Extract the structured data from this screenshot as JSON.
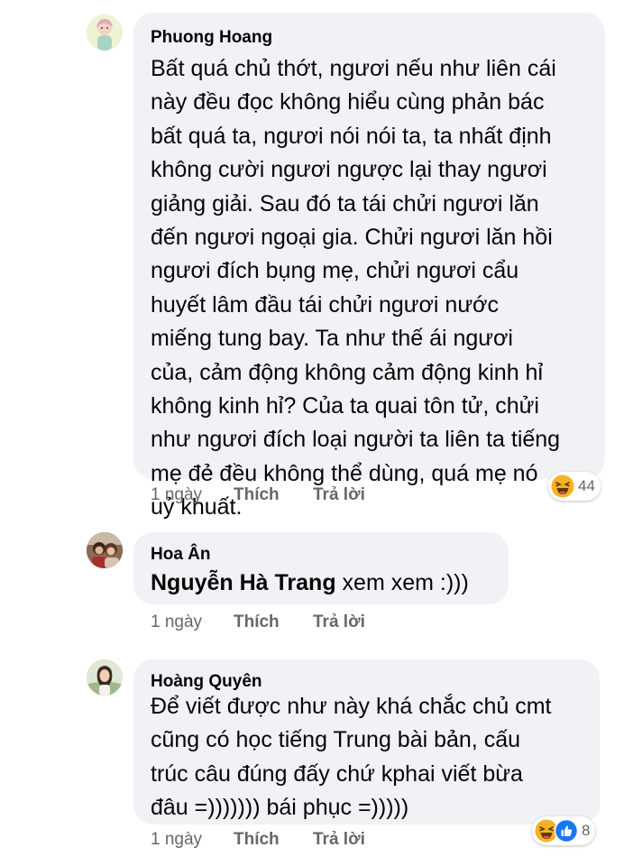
{
  "comments": [
    {
      "author": "Phuong Hoang",
      "lines": [
        "Bất quá chủ thớt, ngươi nếu như liên cái",
        "này đều đọc không hiểu cùng phản bác",
        "bất quá ta, ngươi nói nói ta, ta nhất định",
        "không cười ngươi ngược lại thay ngươi",
        "giảng giải. Sau đó ta tái chửi ngươi lăn",
        "đến ngươi ngoại gia. Chửi ngươi lăn hồi",
        "ngươi đích bụng mẹ, chửi ngươi cẩu",
        "huyết lâm đầu tái chửi ngươi nước",
        "miếng tung bay. Ta như thế ái ngươi",
        "của, cảm động không cảm động kinh hỉ",
        "không kinh hỉ? Của ta quai tôn tử, chửi",
        "như ngươi đích loại người ta liên ta tiếng",
        "mẹ đẻ đều không thể dùng, quá mẹ nó",
        "uỷ khuất."
      ],
      "time": "1 ngày",
      "like_label": "Thích",
      "reply_label": "Trả lời",
      "reactions": {
        "icons": [
          "haha-icon"
        ],
        "count": "44"
      }
    },
    {
      "author": "Hoa Ân",
      "mention": "Nguyễn Hà Trang",
      "text": " xem xem :)))",
      "time": "1 ngày",
      "like_label": "Thích",
      "reply_label": "Trả lời"
    },
    {
      "author": "Hoàng Quyên",
      "lines": [
        "Để viết được như này khá chắc chủ cmt",
        "cũng có học tiếng Trung bài bản, cấu",
        "trúc câu đúng đấy chứ kphai viết bừa",
        "đâu =))))))) bái phục =)))))"
      ],
      "time": "1 ngày",
      "like_label": "Thích",
      "reply_label": "Trả lời",
      "reactions": {
        "icons": [
          "haha-icon",
          "like-icon"
        ],
        "count": "8"
      }
    }
  ],
  "colors": {
    "bubble": "#f0f2f5",
    "meta_text": "#65676b",
    "haha": "#f7b125",
    "like": "#1877f2"
  }
}
